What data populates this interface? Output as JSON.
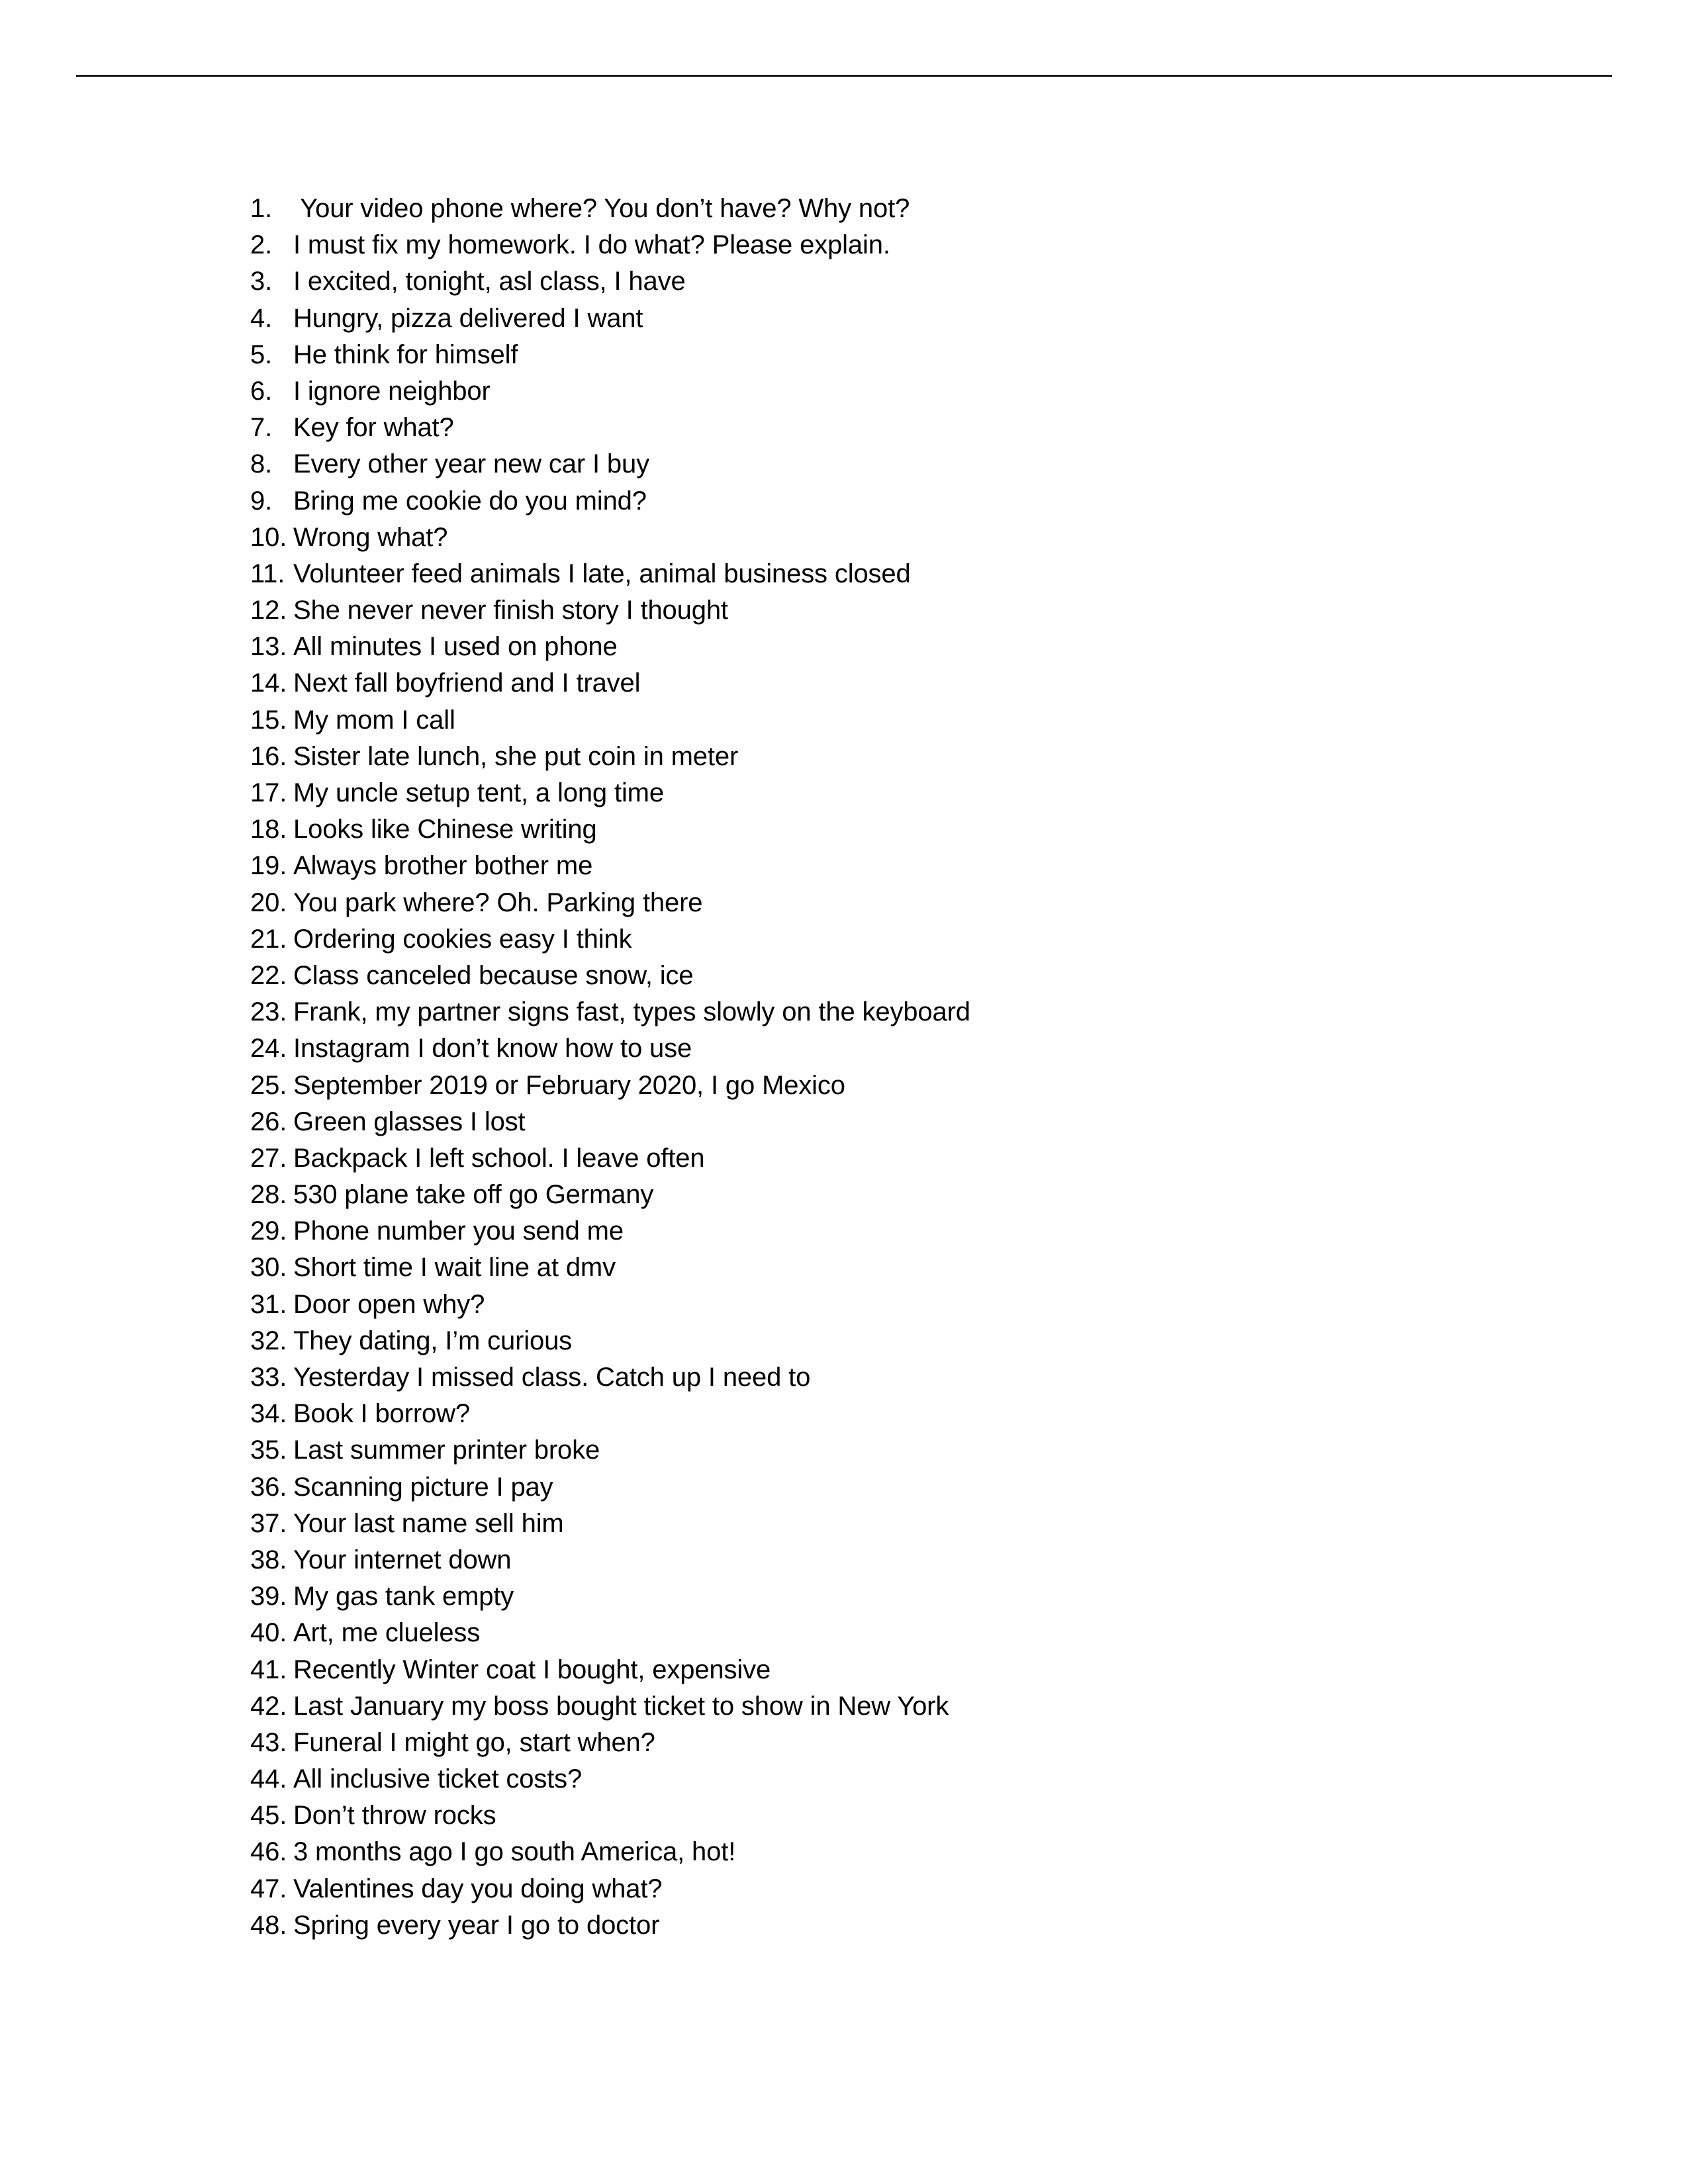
{
  "document": {
    "header_rule": "horizontal-rule",
    "list": {
      "type": "ordered-decimal",
      "items": [
        {
          "number": "1.",
          "text": " Your video phone where? You don’t have? Why not?"
        },
        {
          "number": "2.",
          "text": "I must fix my homework. I do what? Please explain."
        },
        {
          "number": "3.",
          "text": "I excited, tonight, asl class, I have"
        },
        {
          "number": "4.",
          "text": "Hungry, pizza delivered I want"
        },
        {
          "number": "5.",
          "text": "He think for himself"
        },
        {
          "number": "6.",
          "text": "I ignore neighbor"
        },
        {
          "number": "7.",
          "text": "Key for what?"
        },
        {
          "number": "8.",
          "text": "Every other year new car I buy"
        },
        {
          "number": "9.",
          "text": "Bring me cookie do you mind?"
        },
        {
          "number": "10.",
          "text": "Wrong what?"
        },
        {
          "number": "11.",
          "text": "Volunteer feed animals I late, animal business closed"
        },
        {
          "number": "12.",
          "text": "She never never finish story I thought"
        },
        {
          "number": "13.",
          "text": "All minutes I used on phone"
        },
        {
          "number": "14.",
          "text": "Next fall boyfriend and I travel"
        },
        {
          "number": "15.",
          "text": "My mom I call"
        },
        {
          "number": "16.",
          "text": "Sister late lunch, she put coin in meter"
        },
        {
          "number": "17.",
          "text": "My uncle setup tent, a long time"
        },
        {
          "number": "18.",
          "text": "Looks like Chinese writing"
        },
        {
          "number": "19.",
          "text": "Always brother bother me"
        },
        {
          "number": "20.",
          "text": "You park where? Oh. Parking there"
        },
        {
          "number": "21.",
          "text": "Ordering cookies easy I think"
        },
        {
          "number": "22.",
          "text": "Class canceled because snow, ice"
        },
        {
          "number": "23.",
          "text": "Frank, my partner signs fast, types slowly on the keyboard"
        },
        {
          "number": "24.",
          "text": "Instagram I don’t know how to use"
        },
        {
          "number": "25.",
          "text": "September 2019 or February 2020, I go Mexico"
        },
        {
          "number": "26.",
          "text": "Green glasses I lost"
        },
        {
          "number": "27.",
          "text": "Backpack I left school. I leave often"
        },
        {
          "number": "28.",
          "text": "530 plane take off go Germany"
        },
        {
          "number": "29.",
          "text": "Phone number you send me"
        },
        {
          "number": "30.",
          "text": "Short time I wait line at dmv"
        },
        {
          "number": "31.",
          "text": "Door open why?"
        },
        {
          "number": "32.",
          "text": "They dating, I’m curious"
        },
        {
          "number": "33.",
          "text": "Yesterday I missed class. Catch up I need to"
        },
        {
          "number": "34.",
          "text": "Book I borrow?"
        },
        {
          "number": "35.",
          "text": "Last summer printer broke"
        },
        {
          "number": "36.",
          "text": "Scanning picture I pay"
        },
        {
          "number": "37.",
          "text": "Your last name sell him"
        },
        {
          "number": "38.",
          "text": "Your internet down"
        },
        {
          "number": "39.",
          "text": "My gas tank empty"
        },
        {
          "number": "40.",
          "text": "Art, me clueless"
        },
        {
          "number": "41.",
          "text": "Recently Winter coat I bought, expensive"
        },
        {
          "number": "42.",
          "text": "Last January my boss bought ticket to show in New York"
        },
        {
          "number": "43.",
          "text": "Funeral I might go, start when?"
        },
        {
          "number": "44.",
          "text": "All inclusive ticket costs?"
        },
        {
          "number": "45.",
          "text": "Don’t throw rocks"
        },
        {
          "number": "46.",
          "text": "3 months ago I go south America, hot!"
        },
        {
          "number": "47.",
          "text": "Valentines day you doing what?"
        },
        {
          "number": "48.",
          "text": "Spring every year I go to doctor"
        }
      ]
    }
  }
}
